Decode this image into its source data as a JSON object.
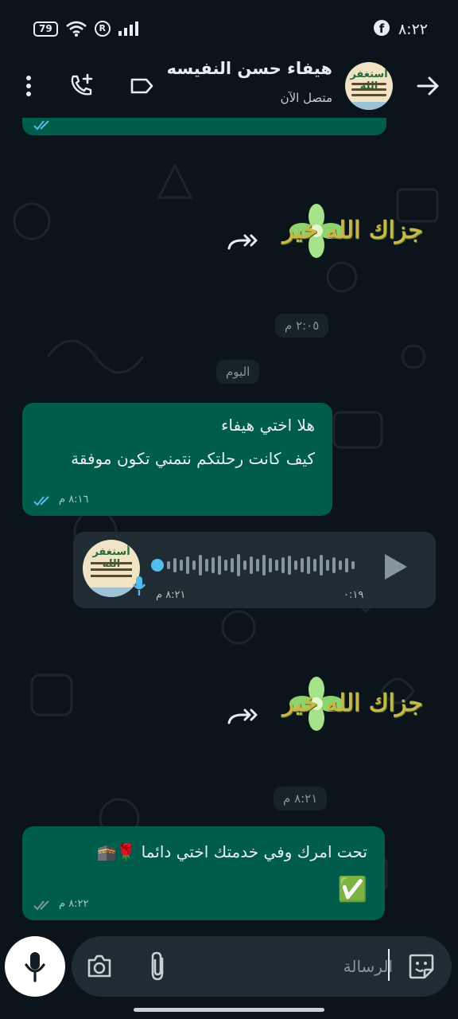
{
  "status_bar": {
    "time": "٨:٢٢",
    "battery": "79",
    "facebook_icon": "facebook-icon",
    "wifi_icon": "wifi-icon",
    "registered_icon": "registered-icon",
    "signal_icon": "signal-icon"
  },
  "header": {
    "contact_name": "هيفاء حسن النفيسه",
    "status": "متصل الآن",
    "avatar_text": "أستغفر الله",
    "icons": [
      "back-arrow-icon",
      "label-icon",
      "add-call-icon",
      "more-vert-icon"
    ]
  },
  "messages": [
    {
      "type": "sticker",
      "caption_text": "جزاك الله خير",
      "forward_icon": "forward-icon",
      "time": "٢:٠٥ م"
    },
    {
      "type": "date",
      "label": "اليوم"
    },
    {
      "type": "text",
      "direction": "outgoing",
      "lines": [
        "هلا اختي هيفاء",
        "كيف كانت رحلتكم نتمني تكون موفقة"
      ],
      "time": "٨:١٦ م",
      "status": "read"
    },
    {
      "type": "voice",
      "direction": "incoming",
      "duration": "٠:١٩",
      "time": "٨:٢١ م",
      "avatar_text": "أستغفر الله"
    },
    {
      "type": "sticker",
      "caption_text": "جزاك الله خير",
      "forward_icon": "forward-icon",
      "time": "٨:٢١ م"
    },
    {
      "type": "text",
      "direction": "outgoing",
      "lines": [
        "تحت امرك وفي خدمتك اختي دائما 🌹🕋",
        "✅"
      ],
      "time": "٨:٢٢ م",
      "status": "delivered"
    }
  ],
  "composer": {
    "placeholder": "الرسالة",
    "icons": [
      "sticker-icon",
      "attach-icon",
      "camera-icon",
      "mic-icon"
    ]
  },
  "colors": {
    "background": "#0b141a",
    "outgoing_bubble": "#005c4b",
    "incoming_bubble": "#202c33",
    "read_ticks": "#53bdeb",
    "accent": "#00a884"
  }
}
